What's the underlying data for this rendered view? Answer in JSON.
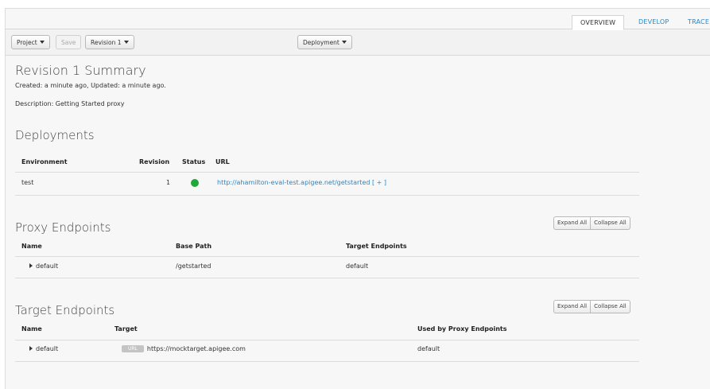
{
  "tabs": [
    {
      "label": "OVERVIEW",
      "active": true
    },
    {
      "label": "DEVELOP",
      "active": false
    },
    {
      "label": "TRACE",
      "active": false
    }
  ],
  "toolbar": {
    "project_label": "Project",
    "save_label": "Save",
    "revision_label": "Revision 1",
    "deployment_label": "Deployment"
  },
  "summary": {
    "title": "Revision 1 Summary",
    "created": "Created: a minute ago, Updated: a minute ago.",
    "description": "Description: Getting Started proxy"
  },
  "deployments": {
    "title": "Deployments",
    "headers": [
      "Environment",
      "Revision",
      "Status",
      "URL"
    ],
    "rows": [
      {
        "environment": "test",
        "revision": "1",
        "status_color": "#22a83a",
        "url": "http://ahamilton-eval-test.apigee.net/getstarted",
        "add": "[ + ]"
      }
    ]
  },
  "proxy_endpoints": {
    "title": "Proxy Endpoints",
    "expand_label": "Expand All",
    "collapse_label": "Collapse All",
    "headers": [
      "Name",
      "Base Path",
      "Target Endpoints"
    ],
    "rows": [
      {
        "name": "default",
        "base_path": "/getstarted",
        "target_endpoints": "default"
      }
    ]
  },
  "target_endpoints": {
    "title": "Target Endpoints",
    "expand_label": "Expand All",
    "collapse_label": "Collapse All",
    "headers": [
      "Name",
      "Target",
      "Used by Proxy Endpoints"
    ],
    "rows": [
      {
        "name": "default",
        "badge": "URL",
        "target": "https://mocktarget.apigee.com",
        "used_by": "default"
      }
    ]
  },
  "colors": {
    "link": "#2b86c5",
    "status_ok": "#22a83a"
  }
}
